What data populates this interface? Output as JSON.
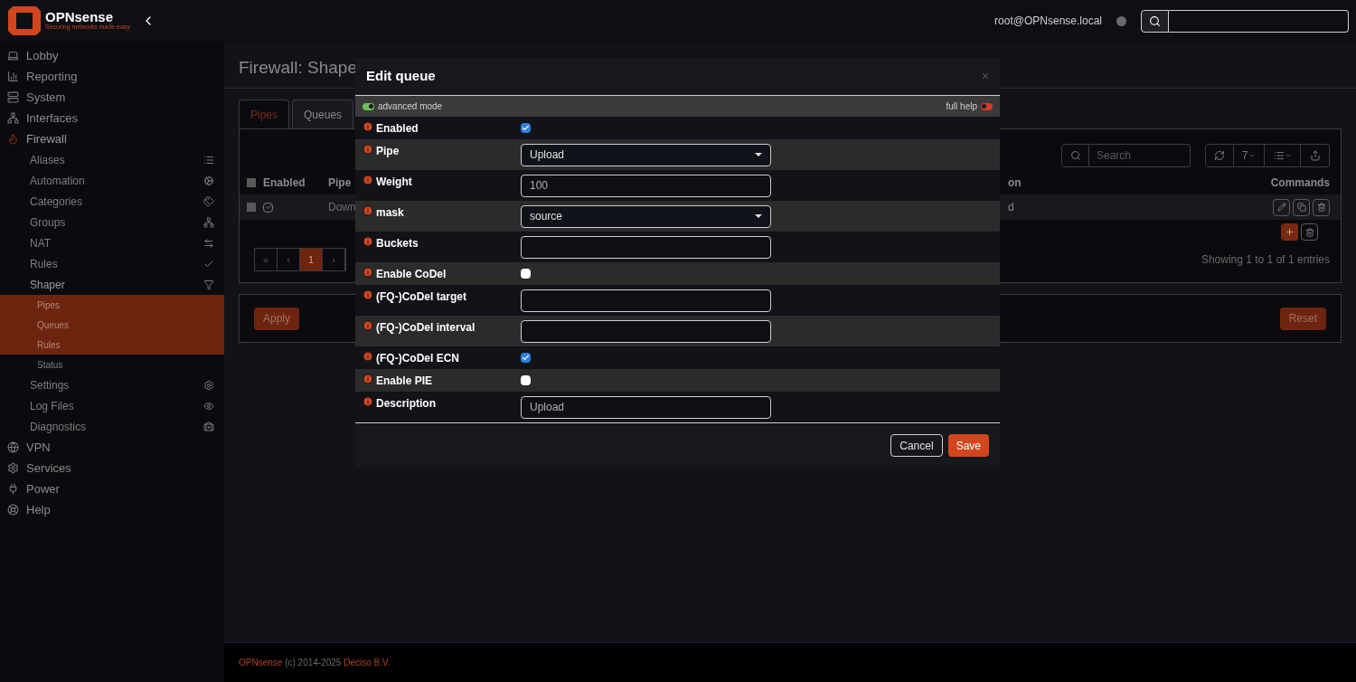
{
  "header": {
    "brand": "OPNsense",
    "tagline": "Securing networks made easy",
    "user": "root@OPNsense.local"
  },
  "sidebar": {
    "items": [
      {
        "label": "Lobby",
        "expanded": false
      },
      {
        "label": "Reporting",
        "expanded": false
      },
      {
        "label": "System",
        "expanded": false
      },
      {
        "label": "Interfaces",
        "expanded": false
      },
      {
        "label": "Firewall",
        "expanded": true,
        "children": [
          {
            "label": "Aliases"
          },
          {
            "label": "Automation"
          },
          {
            "label": "Categories"
          },
          {
            "label": "Groups"
          },
          {
            "label": "NAT"
          },
          {
            "label": "Rules"
          },
          {
            "label": "Shaper",
            "expanded": true,
            "children": [
              {
                "label": "Pipes",
                "selected": true
              },
              {
                "label": "Queues",
                "selected": true
              },
              {
                "label": "Rules",
                "selected": true
              },
              {
                "label": "Status",
                "selected": false
              }
            ]
          },
          {
            "label": "Settings"
          },
          {
            "label": "Log Files"
          },
          {
            "label": "Diagnostics"
          }
        ]
      },
      {
        "label": "VPN",
        "expanded": false
      },
      {
        "label": "Services",
        "expanded": false
      },
      {
        "label": "Power",
        "expanded": false
      },
      {
        "label": "Help",
        "expanded": false
      }
    ]
  },
  "page": {
    "title": "Firewall: Shape",
    "tabs": [
      {
        "label": "Pipes",
        "selected": true
      },
      {
        "label": "Queues",
        "selected": false
      }
    ],
    "search": {
      "placeholder": "Search"
    },
    "page_size": "7",
    "table": {
      "all_selected": false,
      "columns": [
        "Enabled",
        "Pipe",
        "on",
        "Commands"
      ],
      "rows": [
        {
          "selected": false,
          "enabled": true,
          "pipe": "Down",
          "column_3": "d"
        }
      ]
    },
    "pagination": [
      {
        "label": "«",
        "selected": false
      },
      {
        "label": "‹",
        "selected": false
      },
      {
        "label": "1",
        "selected": true
      },
      {
        "label": "›",
        "selected": false
      }
    ],
    "info": "Showing 1 to 1 of 1 entries",
    "apply": "Apply",
    "reset": "Reset"
  },
  "modal": {
    "title": "Edit queue",
    "close": "×",
    "advanced_mode": {
      "label": "advanced mode",
      "on": true
    },
    "full_help": {
      "label": "full help",
      "on": false
    },
    "fields": [
      {
        "label": "Enabled",
        "kind": "checkbox",
        "checked": true
      },
      {
        "label": "Pipe",
        "kind": "select",
        "value": "Upload"
      },
      {
        "label": "Weight",
        "kind": "text",
        "value": "100"
      },
      {
        "label": "mask",
        "kind": "select",
        "value": "source"
      },
      {
        "label": "Buckets",
        "kind": "text"
      },
      {
        "label": "Enable CoDel",
        "kind": "checkbox",
        "checked": false
      },
      {
        "label": "(FQ-)CoDel target",
        "kind": "text"
      },
      {
        "label": "(FQ-)CoDel interval",
        "kind": "text"
      },
      {
        "label": "(FQ-)CoDel ECN",
        "kind": "checkbox",
        "checked": true
      },
      {
        "label": "Enable PIE",
        "kind": "checkbox",
        "checked": false
      },
      {
        "label": "Description",
        "kind": "text",
        "value": "Upload"
      }
    ],
    "buttons": [
      {
        "label": "Cancel",
        "kind": "secondary"
      },
      {
        "label": "Save",
        "kind": "primary"
      }
    ]
  },
  "footer": {
    "brand": "OPNsense",
    "copyright": "(c) 2014-2025",
    "company": "Deciso B.V."
  }
}
